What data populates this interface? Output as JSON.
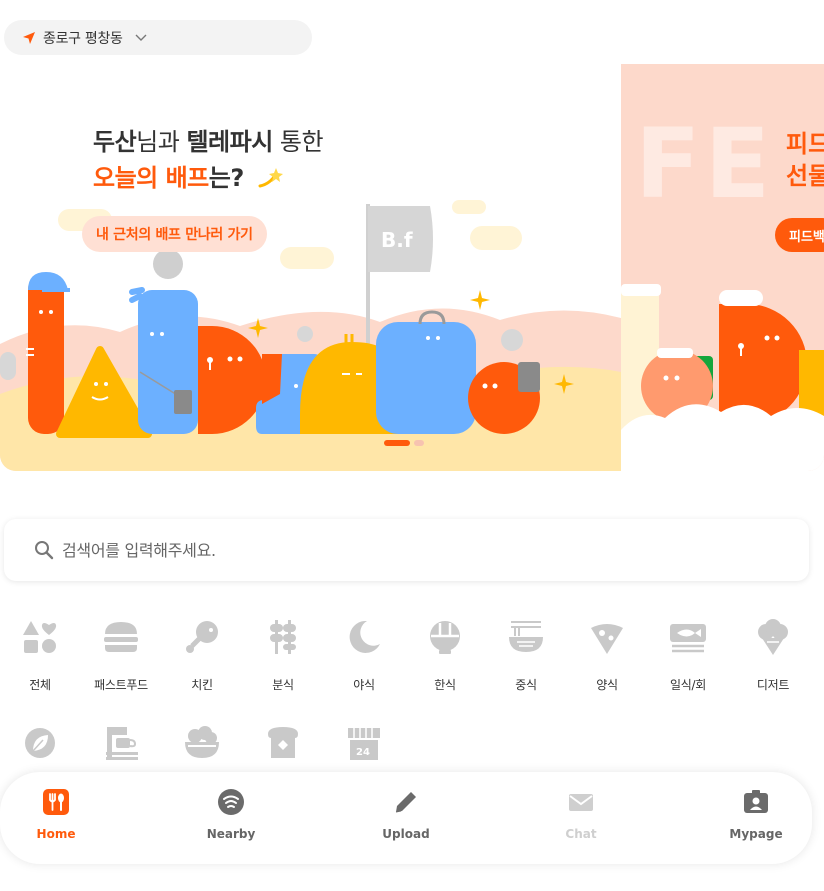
{
  "location": {
    "label": "종로구 평창동"
  },
  "banner": {
    "slide1": {
      "line1_bold1": "두산",
      "line1_light1": "님과 ",
      "line1_bold2": "텔레파시",
      "line1_light2": " 통한",
      "line2_orange": "오늘의 배프",
      "line2_rest": "는?",
      "cta": "내 근처의 배프 만나러 가기",
      "flag_text": "B.f"
    },
    "slide2": {
      "bg_text": "FE",
      "title_line1": "피드",
      "title_line2": "선물",
      "cta": "피드백"
    },
    "page_count": 2,
    "active_page": 1
  },
  "search": {
    "placeholder": "검색어를 입력해주세요."
  },
  "categories": [
    {
      "label": "전체",
      "icon": "shapes-icon"
    },
    {
      "label": "패스트푸드",
      "icon": "burger-icon"
    },
    {
      "label": "치킨",
      "icon": "drumstick-icon"
    },
    {
      "label": "분식",
      "icon": "skewer-icon"
    },
    {
      "label": "야식",
      "icon": "moon-icon"
    },
    {
      "label": "한식",
      "icon": "bibimbap-icon"
    },
    {
      "label": "중식",
      "icon": "noodle-bowl-icon"
    },
    {
      "label": "양식",
      "icon": "pizza-icon"
    },
    {
      "label": "일식/회",
      "icon": "fish-icon"
    },
    {
      "label": "디저트",
      "icon": "ice-cream-icon"
    },
    {
      "label": "",
      "icon": "leaf-icon"
    },
    {
      "label": "",
      "icon": "coffee-machine-icon"
    },
    {
      "label": "",
      "icon": "salad-bowl-icon"
    },
    {
      "label": "",
      "icon": "bread-icon"
    },
    {
      "label": "",
      "icon": "store-24-icon"
    }
  ],
  "nav": [
    {
      "label": "Home",
      "icon": "fork-spoon-icon",
      "state": "active"
    },
    {
      "label": "Nearby",
      "icon": "signal-icon",
      "state": "normal"
    },
    {
      "label": "Upload",
      "icon": "pencil-icon",
      "state": "normal"
    },
    {
      "label": "Chat",
      "icon": "mail-icon",
      "state": "disabled"
    },
    {
      "label": "Mypage",
      "icon": "profile-icon",
      "state": "normal"
    }
  ],
  "colors": {
    "accent": "#ff5a0c",
    "icon_gray": "#c9c9c9",
    "nav_gray": "#666666",
    "banner_peach": "#fdd9cb"
  }
}
